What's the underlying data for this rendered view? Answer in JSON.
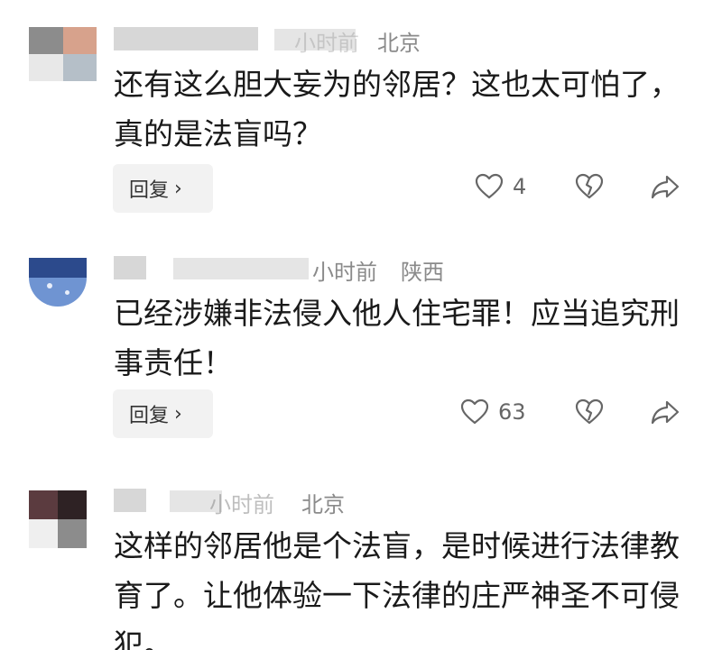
{
  "comments": [
    {
      "time": "小时前",
      "location": "北京",
      "text": "还有这么胆大妄为的邻居？这也太可怕了，真的是法盲吗？",
      "reply_label": "回复",
      "likes": "4",
      "avatar_colors": [
        "#7f7f7f",
        "#d9a28c",
        "#a8b7c4"
      ]
    },
    {
      "time": "小时前",
      "location": "陕西",
      "text": "已经涉嫌非法侵入他人住宅罪！应当追究刑事责任！",
      "reply_label": "回复",
      "likes": "63",
      "avatar_colors": [
        "#2e4a8a",
        "#6c8fcf",
        "#e6eef9"
      ]
    },
    {
      "time": "小时前",
      "location": "北京",
      "text": "这样的邻居他是个法盲，是时候进行法律教育了。让他体验一下法律的庄严神圣不可侵犯。",
      "avatar_colors": [
        "#5a3a3e",
        "#3b2a2c",
        "#8b6a6e"
      ]
    }
  ],
  "icons": {
    "like": "heart-icon",
    "dislike": "broken-heart-icon",
    "share": "share-icon",
    "reply_chevron": "chevron-right-icon"
  }
}
